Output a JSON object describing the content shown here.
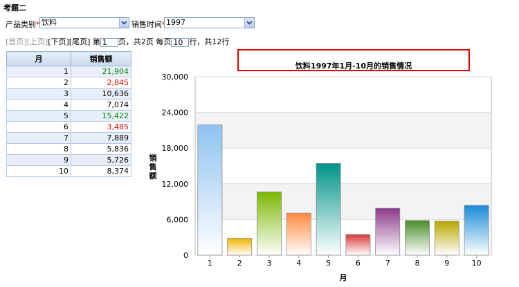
{
  "page": {
    "title": "考题二"
  },
  "filters": {
    "category_label": "产品类别",
    "category_value": "饮料",
    "time_label": "销售时间",
    "time_value": "1997",
    "required_mark": "*"
  },
  "pager": {
    "first": "[首页]",
    "prev": "[上页]",
    "next": "[下页]",
    "last": "[尾页]",
    "page_prefix": "第",
    "page_value": "1",
    "page_suffix": "页，共2页 每页",
    "per_page_value": "10",
    "rows_suffix": "行，共12行"
  },
  "table": {
    "headers": [
      "月",
      "销售额"
    ],
    "rows": [
      {
        "month": "1",
        "sales": "21,904",
        "color": "green"
      },
      {
        "month": "2",
        "sales": "2,845",
        "color": "red"
      },
      {
        "month": "3",
        "sales": "10,636",
        "color": ""
      },
      {
        "month": "4",
        "sales": "7,074",
        "color": ""
      },
      {
        "month": "5",
        "sales": "15,422",
        "color": "green"
      },
      {
        "month": "6",
        "sales": "3,485",
        "color": "red"
      },
      {
        "month": "7",
        "sales": "7,889",
        "color": ""
      },
      {
        "month": "8",
        "sales": "5,836",
        "color": ""
      },
      {
        "month": "9",
        "sales": "5,726",
        "color": ""
      },
      {
        "month": "10",
        "sales": "8,374",
        "color": ""
      }
    ]
  },
  "chart_data": {
    "type": "bar",
    "title": "饮料1997年1月-10月的销售情况",
    "xlabel": "月",
    "ylabel": "销售额",
    "categories": [
      "1",
      "2",
      "3",
      "4",
      "5",
      "6",
      "7",
      "8",
      "9",
      "10"
    ],
    "values": [
      21904,
      2845,
      10636,
      7074,
      15422,
      3485,
      7889,
      5836,
      5726,
      8374
    ],
    "ylim": [
      0,
      30000
    ],
    "yticks": [
      0,
      6000,
      12000,
      18000,
      24000,
      30000
    ],
    "ytick_labels": [
      "0",
      "6,000",
      "12,000",
      "18,000",
      "24,000",
      "30,000"
    ],
    "bar_colors": [
      "#8ec3f0",
      "#f0b400",
      "#7cb800",
      "#ff8a3d",
      "#009488",
      "#d93a3a",
      "#8c3a8c",
      "#4a8c2a",
      "#b8a800",
      "#1a8ad6"
    ],
    "grid": true,
    "legend": "none"
  }
}
